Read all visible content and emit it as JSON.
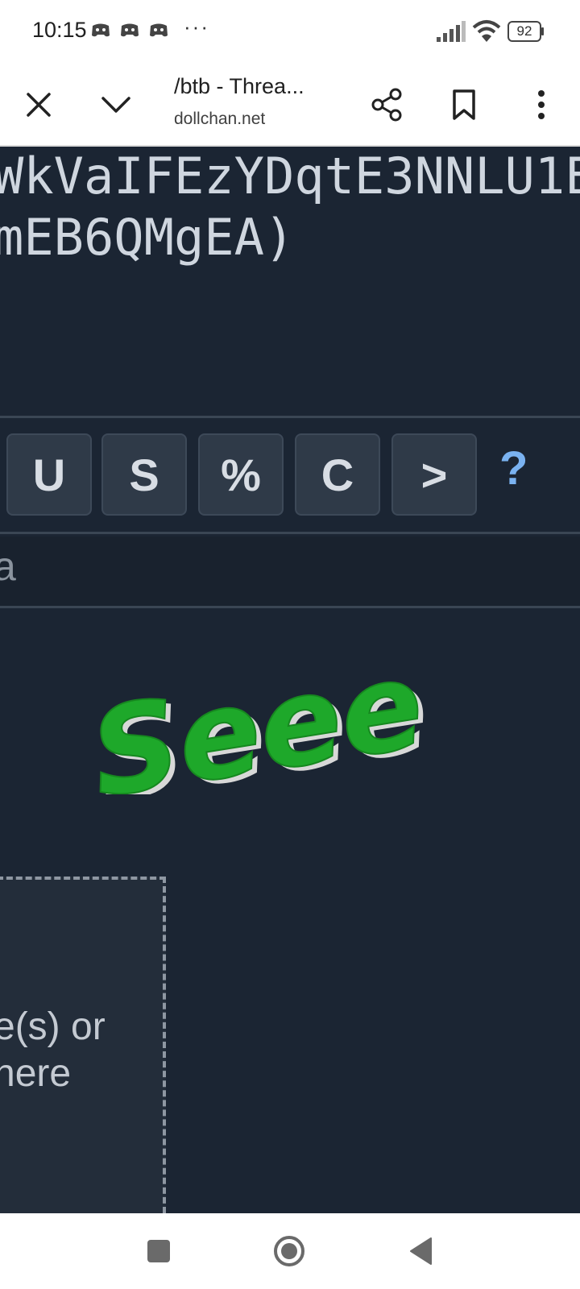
{
  "status_bar": {
    "time": "10:15",
    "more": "···",
    "battery": "92",
    "icons": [
      "notification-app-icon",
      "notification-app-icon",
      "notification-app-icon",
      "signal-icon",
      "wifi-icon",
      "battery-icon"
    ]
  },
  "browser": {
    "title": "/btb - Threa...",
    "domain": "dollchan.net",
    "icons": [
      "close-icon",
      "chevron-down-icon",
      "share-icon",
      "bookmark-icon",
      "more-vert-icon"
    ]
  },
  "post": {
    "code_line1": "WkVaIFEzYDqtE3NNLU1E",
    "code_line2": "mEB6QMgEA)"
  },
  "formatting": {
    "buttons": [
      "U",
      "S",
      "%",
      "C",
      ">"
    ],
    "help": "?"
  },
  "reply": {
    "textarea_value": "a"
  },
  "captcha": {
    "text": "Seee",
    "color": "#1ea82a"
  },
  "dropzone": {
    "line1": "e(s) or",
    "line2": "here"
  },
  "theme": {
    "background": "#1b2533",
    "button_bg": "#2f3a48",
    "accent": "#7ab2f0"
  }
}
